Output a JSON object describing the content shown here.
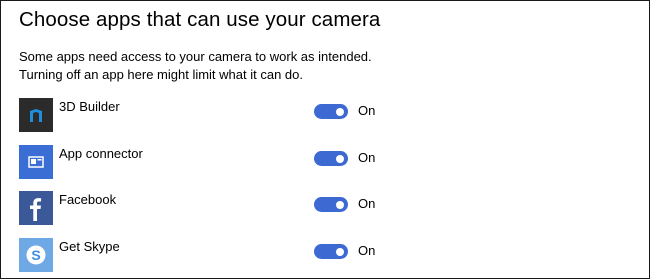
{
  "title": "Choose apps that can use your camera",
  "description_line1": "Some apps need access to your camera to work as intended.",
  "description_line2": "Turning off an app here might limit what it can do.",
  "colors": {
    "toggle_on": "#3c6ad2",
    "builder_tile": "#2b2b2b",
    "builder_glyph": "#1f8fdc",
    "connector_tile": "#3b6ed4",
    "facebook_tile": "#3b5998",
    "skype_tile": "#6ea9e6"
  },
  "apps": [
    {
      "name": "3D Builder",
      "toggle_state": "On",
      "icon": "3d-builder-icon"
    },
    {
      "name": "App connector",
      "toggle_state": "On",
      "icon": "app-connector-icon"
    },
    {
      "name": "Facebook",
      "toggle_state": "On",
      "icon": "facebook-icon"
    },
    {
      "name": "Get Skype",
      "toggle_state": "On",
      "icon": "skype-icon"
    }
  ]
}
